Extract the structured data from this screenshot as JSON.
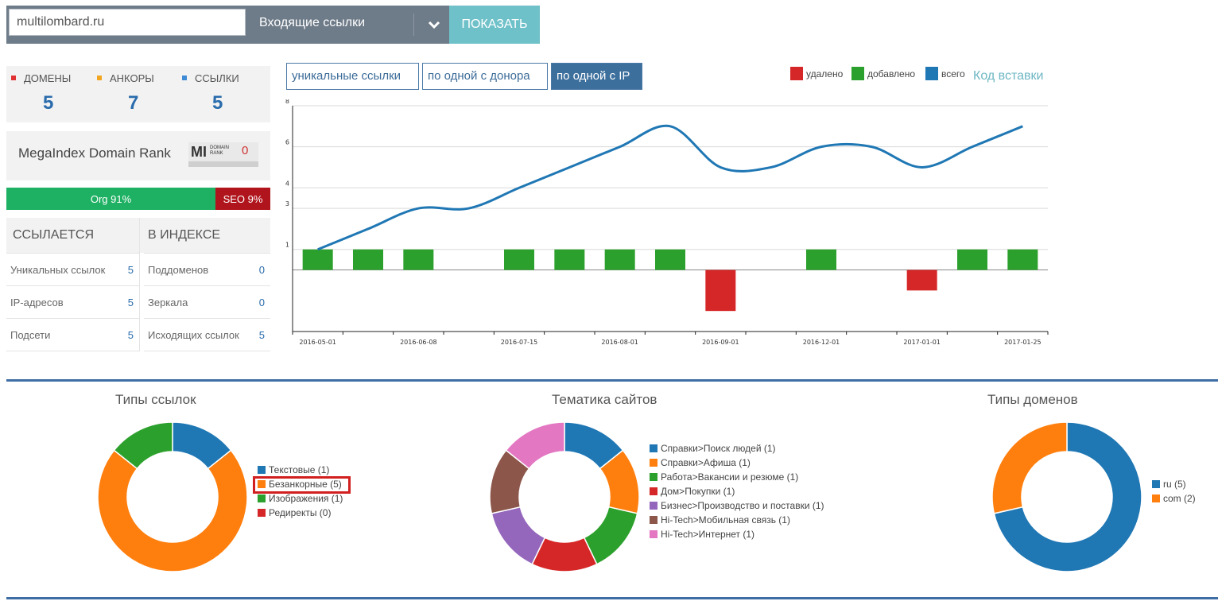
{
  "search": {
    "domain_value": "multilombard.ru",
    "link_type": "Входящие ссылки",
    "show_label": "ПОКАЗАТЬ"
  },
  "counters": [
    {
      "label": "ДОМЕНЫ",
      "value": "5",
      "color": "#e03232"
    },
    {
      "label": "АНКОРЫ",
      "value": "7",
      "color": "#f2a51f"
    },
    {
      "label": "ССЫЛКИ",
      "value": "5",
      "color": "#3d8bd4"
    }
  ],
  "rank": {
    "label": "MegaIndex Domain Rank",
    "badge_mi": "MI",
    "badge_line1": "DOMAIN",
    "badge_line2": "RANK",
    "value": "0"
  },
  "org_seo": {
    "org": "Org 91%",
    "seo": "SEO 9%",
    "org_fraction": 0.91
  },
  "stats": {
    "left_header": "ССЫЛАЕТСЯ",
    "right_header": "В ИНДЕКСЕ",
    "left_rows": [
      {
        "label": "Уникальных ссылок",
        "value": "5"
      },
      {
        "label": "IP-адресов",
        "value": "5"
      },
      {
        "label": "Подсети",
        "value": "5"
      }
    ],
    "right_rows": [
      {
        "label": "Поддоменов",
        "value": "0"
      },
      {
        "label": "Зеркала",
        "value": "0"
      },
      {
        "label": "Исходящих ссылок",
        "value": "5"
      }
    ]
  },
  "tabs": [
    {
      "label": "уникальные ссылки",
      "active": false
    },
    {
      "label": "по одной с донора",
      "active": false
    },
    {
      "label": "по одной с IP",
      "active": true
    }
  ],
  "chart_legend": [
    {
      "label": "удалено",
      "color": "#d62728"
    },
    {
      "label": "добавлено",
      "color": "#2ca02c"
    },
    {
      "label": "всего",
      "color": "#1f77b4"
    }
  ],
  "embed_link": "Код вставки",
  "chart_data": {
    "type": "bar",
    "x_tick_labels": [
      "2016-05-01",
      "2016-06-08",
      "2016-07-15",
      "2016-08-01",
      "2016-09-01",
      "2016-12-01",
      "2017-01-01",
      "2017-01-25"
    ],
    "y_tick_labels": [
      "1",
      "3",
      "4",
      "6",
      "8"
    ],
    "ylim": [
      -3,
      8
    ],
    "series": [
      {
        "name": "добавлено",
        "color": "#2ca02c",
        "values": [
          1,
          1,
          1,
          0,
          1,
          1,
          1,
          1,
          0,
          0,
          1,
          0,
          0,
          1,
          1
        ]
      },
      {
        "name": "удалено",
        "color": "#d62728",
        "values": [
          0,
          0,
          0,
          0,
          0,
          0,
          0,
          0,
          -2,
          0,
          0,
          0,
          -1,
          0,
          0
        ]
      },
      {
        "name": "всего",
        "color": "#1f77b4",
        "values": [
          1,
          2,
          3,
          3,
          4,
          5,
          6,
          7,
          5,
          5,
          6,
          6,
          5,
          6,
          7
        ]
      }
    ]
  },
  "pies": [
    {
      "title": "Типы ссылок",
      "items": [
        {
          "label": "Текстовые (1)",
          "value": 1,
          "color": "#1f77b4"
        },
        {
          "label": "Безанкорные (5)",
          "value": 5,
          "color": "#ff7f0e"
        },
        {
          "label": "Изображения (1)",
          "value": 1,
          "color": "#2ca02c"
        },
        {
          "label": "Редиректы (0)",
          "value": 0,
          "color": "#d62728"
        }
      ]
    },
    {
      "title": "Тематика сайтов",
      "items": [
        {
          "label": "Справки>Поиск людей (1)",
          "value": 1,
          "color": "#1f77b4"
        },
        {
          "label": "Справки>Афиша (1)",
          "value": 1,
          "color": "#ff7f0e"
        },
        {
          "label": "Работа>Вакансии и резюме (1)",
          "value": 1,
          "color": "#2ca02c"
        },
        {
          "label": "Дом>Покупки (1)",
          "value": 1,
          "color": "#d62728"
        },
        {
          "label": "Бизнес>Производство и поставки (1)",
          "value": 1,
          "color": "#9467bd"
        },
        {
          "label": "Hi-Tech>Мобильная связь (1)",
          "value": 1,
          "color": "#8c564b"
        },
        {
          "label": "Hi-Tech>Интернет (1)",
          "value": 1,
          "color": "#e377c2"
        }
      ]
    },
    {
      "title": "Типы доменов",
      "items": [
        {
          "label": "ru (5)",
          "value": 5,
          "color": "#1f77b4"
        },
        {
          "label": "com (2)",
          "value": 2,
          "color": "#ff7f0e"
        }
      ]
    }
  ]
}
